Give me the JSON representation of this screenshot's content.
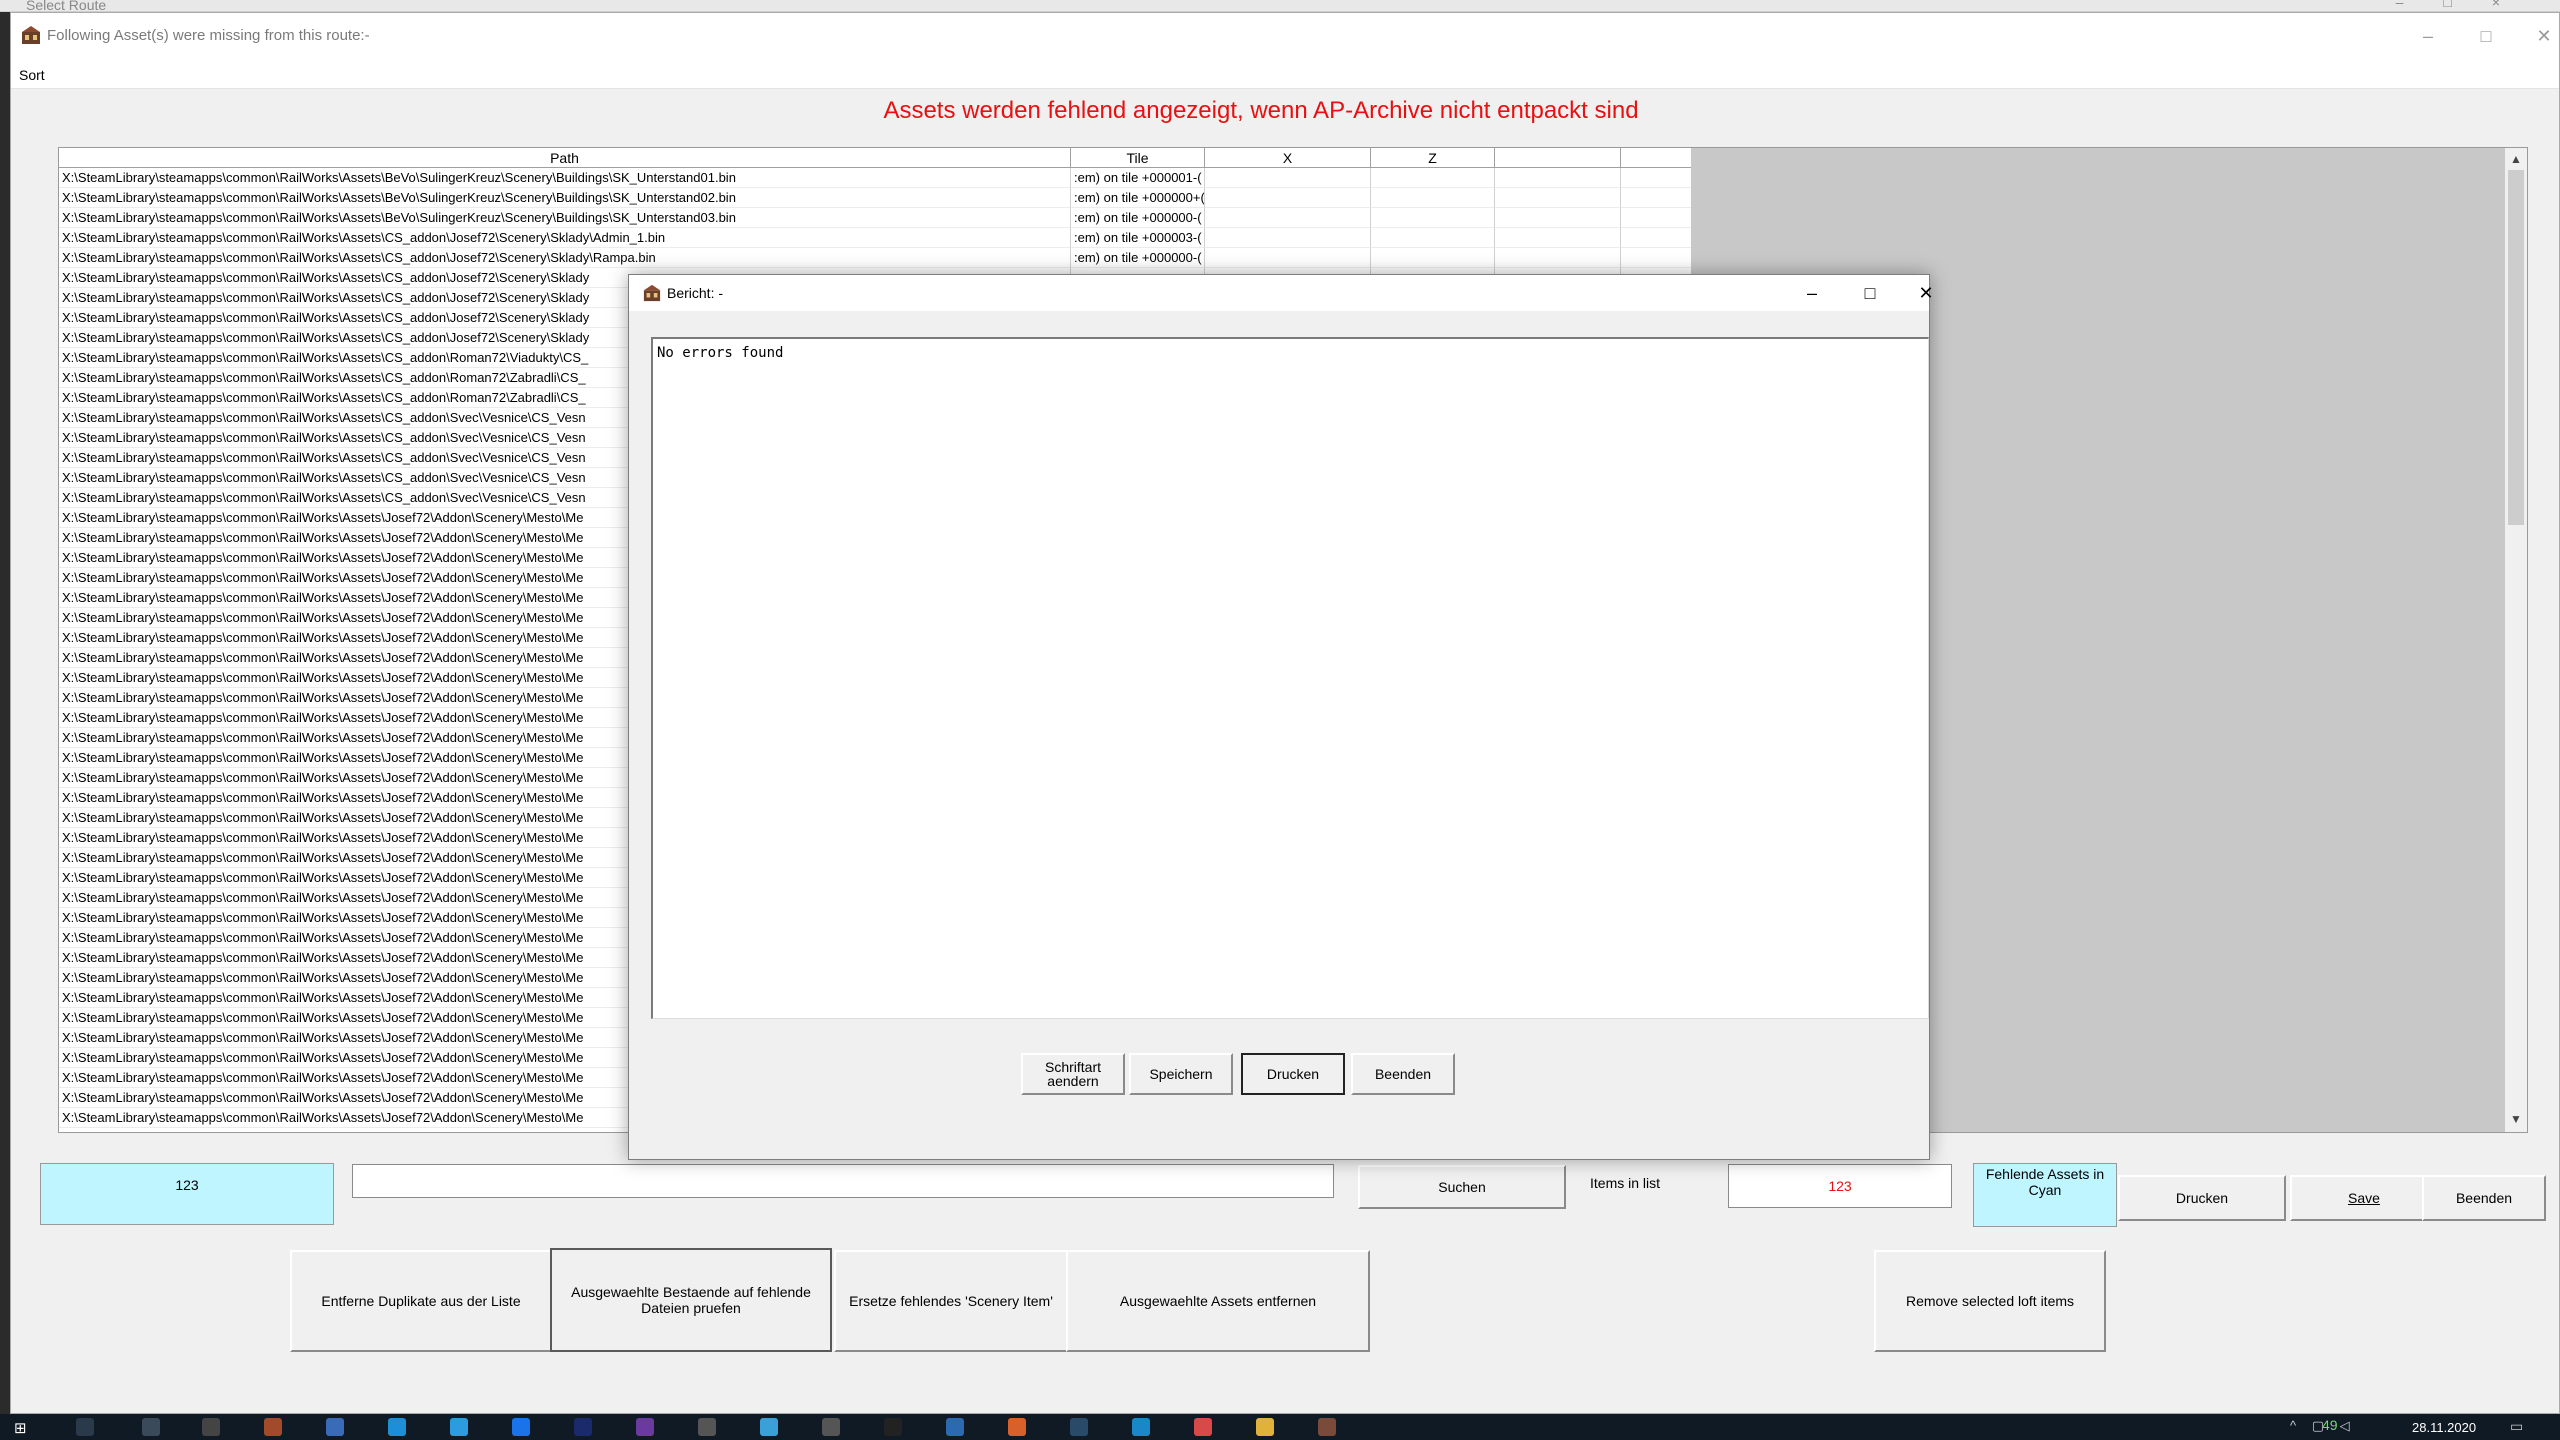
{
  "bg_window": {
    "title": "Select Route"
  },
  "main": {
    "title": "Following Asset(s) were missing from this route:-",
    "menu": [
      "Sort"
    ],
    "info_text": "Assets werden fehlend angezeigt, wenn AP-Archive nicht entpackt sind"
  },
  "table": {
    "headers": [
      "Path",
      "Tile",
      "X",
      "Z",
      "",
      ""
    ],
    "rows": [
      [
        "X:\\SteamLibrary\\steamapps\\common\\RailWorks\\Assets\\BeVo\\SulingerKreuz\\Scenery\\Buildings\\SK_Unterstand01.bin",
        ":em) on tile +000001-(",
        "",
        "",
        "",
        ""
      ],
      [
        "X:\\SteamLibrary\\steamapps\\common\\RailWorks\\Assets\\BeVo\\SulingerKreuz\\Scenery\\Buildings\\SK_Unterstand02.bin",
        ":em) on tile +000000+(",
        "",
        "",
        "",
        ""
      ],
      [
        "X:\\SteamLibrary\\steamapps\\common\\RailWorks\\Assets\\BeVo\\SulingerKreuz\\Scenery\\Buildings\\SK_Unterstand03.bin",
        ":em) on tile +000000-(",
        "",
        "",
        "",
        ""
      ],
      [
        "X:\\SteamLibrary\\steamapps\\common\\RailWorks\\Assets\\CS_addon\\Josef72\\Scenery\\Sklady\\Admin_1.bin",
        ":em) on tile +000003-(",
        "",
        "",
        "",
        ""
      ],
      [
        "X:\\SteamLibrary\\steamapps\\common\\RailWorks\\Assets\\CS_addon\\Josef72\\Scenery\\Sklady\\Rampa.bin",
        ":em) on tile +000000-(",
        "",
        "",
        "",
        ""
      ],
      [
        "X:\\SteamLibrary\\steamapps\\common\\RailWorks\\Assets\\CS_addon\\Josef72\\Scenery\\Sklady",
        "",
        "",
        "",
        "",
        ""
      ],
      [
        "X:\\SteamLibrary\\steamapps\\common\\RailWorks\\Assets\\CS_addon\\Josef72\\Scenery\\Sklady",
        "",
        "",
        "",
        "",
        ""
      ],
      [
        "X:\\SteamLibrary\\steamapps\\common\\RailWorks\\Assets\\CS_addon\\Josef72\\Scenery\\Sklady",
        "",
        "",
        "",
        "",
        ""
      ],
      [
        "X:\\SteamLibrary\\steamapps\\common\\RailWorks\\Assets\\CS_addon\\Josef72\\Scenery\\Sklady",
        "",
        "",
        "",
        "",
        ""
      ],
      [
        "X:\\SteamLibrary\\steamapps\\common\\RailWorks\\Assets\\CS_addon\\Roman72\\Viadukty\\CS_",
        "",
        "",
        "",
        "",
        ""
      ],
      [
        "X:\\SteamLibrary\\steamapps\\common\\RailWorks\\Assets\\CS_addon\\Roman72\\Zabradli\\CS_",
        "",
        "",
        "",
        "",
        ""
      ],
      [
        "X:\\SteamLibrary\\steamapps\\common\\RailWorks\\Assets\\CS_addon\\Roman72\\Zabradli\\CS_",
        "",
        "",
        "",
        "",
        ""
      ],
      [
        "X:\\SteamLibrary\\steamapps\\common\\RailWorks\\Assets\\CS_addon\\Svec\\Vesnice\\CS_Vesn",
        "",
        "",
        "",
        "",
        ""
      ],
      [
        "X:\\SteamLibrary\\steamapps\\common\\RailWorks\\Assets\\CS_addon\\Svec\\Vesnice\\CS_Vesn",
        "",
        "",
        "",
        "",
        ""
      ],
      [
        "X:\\SteamLibrary\\steamapps\\common\\RailWorks\\Assets\\CS_addon\\Svec\\Vesnice\\CS_Vesn",
        "",
        "",
        "",
        "",
        ""
      ],
      [
        "X:\\SteamLibrary\\steamapps\\common\\RailWorks\\Assets\\CS_addon\\Svec\\Vesnice\\CS_Vesn",
        "",
        "",
        "",
        "",
        ""
      ],
      [
        "X:\\SteamLibrary\\steamapps\\common\\RailWorks\\Assets\\CS_addon\\Svec\\Vesnice\\CS_Vesn",
        "",
        "",
        "",
        "",
        ""
      ],
      [
        "X:\\SteamLibrary\\steamapps\\common\\RailWorks\\Assets\\Josef72\\Addon\\Scenery\\Mesto\\Me",
        "",
        "",
        "",
        "",
        ""
      ],
      [
        "X:\\SteamLibrary\\steamapps\\common\\RailWorks\\Assets\\Josef72\\Addon\\Scenery\\Mesto\\Me",
        "",
        "",
        "",
        "",
        ""
      ],
      [
        "X:\\SteamLibrary\\steamapps\\common\\RailWorks\\Assets\\Josef72\\Addon\\Scenery\\Mesto\\Me",
        "",
        "",
        "",
        "",
        ""
      ],
      [
        "X:\\SteamLibrary\\steamapps\\common\\RailWorks\\Assets\\Josef72\\Addon\\Scenery\\Mesto\\Me",
        "",
        "",
        "",
        "",
        ""
      ],
      [
        "X:\\SteamLibrary\\steamapps\\common\\RailWorks\\Assets\\Josef72\\Addon\\Scenery\\Mesto\\Me",
        "",
        "",
        "",
        "",
        ""
      ],
      [
        "X:\\SteamLibrary\\steamapps\\common\\RailWorks\\Assets\\Josef72\\Addon\\Scenery\\Mesto\\Me",
        "",
        "",
        "",
        "",
        ""
      ],
      [
        "X:\\SteamLibrary\\steamapps\\common\\RailWorks\\Assets\\Josef72\\Addon\\Scenery\\Mesto\\Me",
        "",
        "",
        "",
        "",
        ""
      ],
      [
        "X:\\SteamLibrary\\steamapps\\common\\RailWorks\\Assets\\Josef72\\Addon\\Scenery\\Mesto\\Me",
        "",
        "",
        "",
        "",
        ""
      ],
      [
        "X:\\SteamLibrary\\steamapps\\common\\RailWorks\\Assets\\Josef72\\Addon\\Scenery\\Mesto\\Me",
        "",
        "",
        "",
        "",
        ""
      ],
      [
        "X:\\SteamLibrary\\steamapps\\common\\RailWorks\\Assets\\Josef72\\Addon\\Scenery\\Mesto\\Me",
        "",
        "",
        "",
        "",
        ""
      ],
      [
        "X:\\SteamLibrary\\steamapps\\common\\RailWorks\\Assets\\Josef72\\Addon\\Scenery\\Mesto\\Me",
        "",
        "",
        "",
        "",
        ""
      ],
      [
        "X:\\SteamLibrary\\steamapps\\common\\RailWorks\\Assets\\Josef72\\Addon\\Scenery\\Mesto\\Me",
        "",
        "",
        "",
        "",
        ""
      ],
      [
        "X:\\SteamLibrary\\steamapps\\common\\RailWorks\\Assets\\Josef72\\Addon\\Scenery\\Mesto\\Me",
        "",
        "",
        "",
        "",
        ""
      ],
      [
        "X:\\SteamLibrary\\steamapps\\common\\RailWorks\\Assets\\Josef72\\Addon\\Scenery\\Mesto\\Me",
        "",
        "",
        "",
        "",
        ""
      ],
      [
        "X:\\SteamLibrary\\steamapps\\common\\RailWorks\\Assets\\Josef72\\Addon\\Scenery\\Mesto\\Me",
        "",
        "",
        "",
        "",
        ""
      ],
      [
        "X:\\SteamLibrary\\steamapps\\common\\RailWorks\\Assets\\Josef72\\Addon\\Scenery\\Mesto\\Me",
        "",
        "",
        "",
        "",
        ""
      ],
      [
        "X:\\SteamLibrary\\steamapps\\common\\RailWorks\\Assets\\Josef72\\Addon\\Scenery\\Mesto\\Me",
        "",
        "",
        "",
        "",
        ""
      ],
      [
        "X:\\SteamLibrary\\steamapps\\common\\RailWorks\\Assets\\Josef72\\Addon\\Scenery\\Mesto\\Me",
        "",
        "",
        "",
        "",
        ""
      ],
      [
        "X:\\SteamLibrary\\steamapps\\common\\RailWorks\\Assets\\Josef72\\Addon\\Scenery\\Mesto\\Me",
        "",
        "",
        "",
        "",
        ""
      ],
      [
        "X:\\SteamLibrary\\steamapps\\common\\RailWorks\\Assets\\Josef72\\Addon\\Scenery\\Mesto\\Me",
        "",
        "",
        "",
        "",
        ""
      ],
      [
        "X:\\SteamLibrary\\steamapps\\common\\RailWorks\\Assets\\Josef72\\Addon\\Scenery\\Mesto\\Me",
        "",
        "",
        "",
        "",
        ""
      ],
      [
        "X:\\SteamLibrary\\steamapps\\common\\RailWorks\\Assets\\Josef72\\Addon\\Scenery\\Mesto\\Me",
        "",
        "",
        "",
        "",
        ""
      ],
      [
        "X:\\SteamLibrary\\steamapps\\common\\RailWorks\\Assets\\Josef72\\Addon\\Scenery\\Mesto\\Me",
        "",
        "",
        "",
        "",
        ""
      ],
      [
        "X:\\SteamLibrary\\steamapps\\common\\RailWorks\\Assets\\Josef72\\Addon\\Scenery\\Mesto\\Me",
        "",
        "",
        "",
        "",
        ""
      ],
      [
        "X:\\SteamLibrary\\steamapps\\common\\RailWorks\\Assets\\Josef72\\Addon\\Scenery\\Mesto\\Me",
        "",
        "",
        "",
        "",
        ""
      ],
      [
        "X:\\SteamLibrary\\steamapps\\common\\RailWorks\\Assets\\Josef72\\Addon\\Scenery\\Mesto\\Me",
        "",
        "",
        "",
        "",
        ""
      ],
      [
        "X:\\SteamLibrary\\steamapps\\common\\RailWorks\\Assets\\Josef72\\Addon\\Scenery\\Mesto\\Me",
        "",
        "",
        "",
        "",
        ""
      ],
      [
        "X:\\SteamLibrary\\steamapps\\common\\RailWorks\\Assets\\Josef72\\Addon\\Scenery\\Mesto\\Me",
        "",
        "",
        "",
        "",
        ""
      ],
      [
        "X:\\SteamLibrary\\steamapps\\common\\RailWorks\\Assets\\Josef72\\Addon\\Scenery\\Mesto\\Me",
        "",
        "",
        "",
        "",
        ""
      ],
      [
        "X:\\SteamLibrary\\steamapps\\common\\RailWorks\\Assets\\Josef72\\Addon\\Scenery\\Mesto\\Me",
        "",
        "",
        "",
        "",
        ""
      ],
      [
        "X:\\SteamLibrary\\steamapps\\common\\RailWorks\\Assets\\Josef72\\Addon\\Scenery\\Mesto\\Me",
        "",
        "",
        "",
        "",
        ""
      ]
    ]
  },
  "bottom": {
    "count_left": "123",
    "search_value": "",
    "search_label": "Suchen",
    "items_in_list_label": "Items in list",
    "items_in_list_value": "123",
    "cyan_legend": "Fehlende Assets in Cyan",
    "print_label": "Drucken",
    "save_label": "Save",
    "quit_label": "Beenden",
    "dedupe_label": "Entferne Duplikate aus der Liste",
    "check_label": "Ausgewaehlte Bestaende auf fehlende Dateien pruefen",
    "replace_label": "Ersetze fehlendes 'Scenery Item'",
    "remove_label": "Ausgewaehlte Assets entfernen",
    "remove_loft_label": "Remove selected loft items"
  },
  "dialog": {
    "title": "Bericht: -",
    "report_text": "No errors found",
    "font_label": "Schriftart aendern",
    "store_label": "Speichern",
    "print_label": "Drucken",
    "quit_label": "Beenden"
  },
  "taskbar": {
    "tray_number": "49",
    "date": "28.11.2020"
  },
  "colors": {
    "warning_red": "#e81010",
    "missing_cyan": "#bff5ff",
    "taskbar": "#101a24"
  }
}
